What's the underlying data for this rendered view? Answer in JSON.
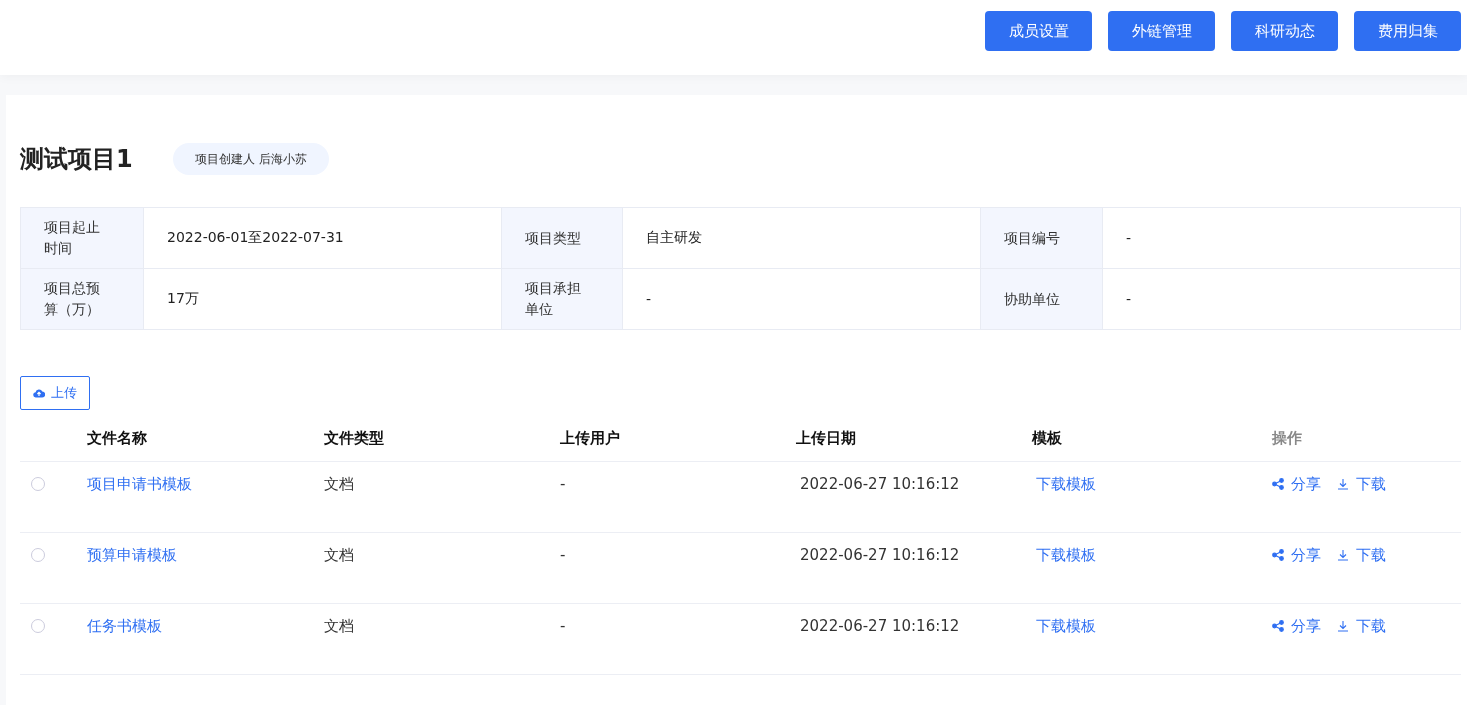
{
  "header": {
    "buttons": [
      "成员设置",
      "外链管理",
      "科研动态",
      "费用归集"
    ]
  },
  "project": {
    "title": "测试项目1",
    "creator_tag": "项目创建人 后海小苏"
  },
  "info": [
    {
      "label": "项目起止时间",
      "value": "2022-06-01至2022-07-31"
    },
    {
      "label": "项目类型",
      "value": "自主研发"
    },
    {
      "label": "项目编号",
      "value": "-"
    },
    {
      "label": "项目总预算（万）",
      "value": "17万"
    },
    {
      "label": "项目承担单位",
      "value": "-"
    },
    {
      "label": "协助单位",
      "value": "-"
    }
  ],
  "upload_button": "上传",
  "files": {
    "columns": [
      "文件名称",
      "文件类型",
      "上传用户",
      "上传日期",
      "模板",
      "操作"
    ],
    "rows": [
      {
        "selected": false,
        "name": "项目申请书模板",
        "type": "文档",
        "user": "-",
        "date": "2022-06-27 10:16:12",
        "template": "下载模板",
        "actions": [
          "分享",
          "下载"
        ]
      },
      {
        "selected": false,
        "name": "预算申请模板",
        "type": "文档",
        "user": "-",
        "date": "2022-06-27 10:16:12",
        "template": "下载模板",
        "actions": [
          "分享",
          "下载"
        ]
      },
      {
        "selected": false,
        "name": "任务书模板",
        "type": "文档",
        "user": "-",
        "date": "2022-06-27 10:16:12",
        "template": "下载模板",
        "actions": [
          "分享",
          "下载"
        ]
      }
    ]
  }
}
